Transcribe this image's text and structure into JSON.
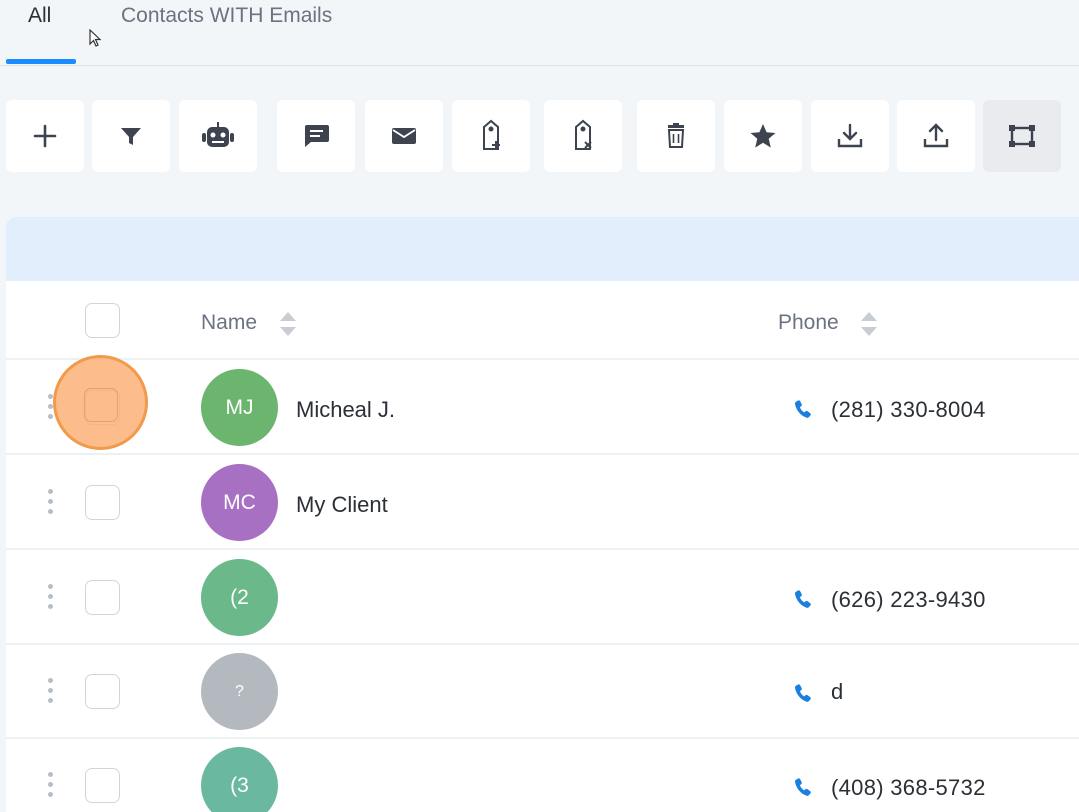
{
  "tabs": [
    {
      "label": "All",
      "active": true
    },
    {
      "label": "Contacts WITH Emails",
      "active": false
    }
  ],
  "toolbar": {
    "buttons": [
      {
        "icon": "plus-icon"
      },
      {
        "icon": "filter-icon"
      },
      {
        "icon": "robot-icon"
      },
      {
        "icon": "message-icon"
      },
      {
        "icon": "email-icon"
      },
      {
        "icon": "add-tag-icon"
      },
      {
        "icon": "remove-tag-icon"
      },
      {
        "icon": "trash-icon"
      },
      {
        "icon": "star-icon"
      },
      {
        "icon": "download-icon"
      },
      {
        "icon": "upload-icon"
      },
      {
        "icon": "columns-icon",
        "active": true
      }
    ]
  },
  "table": {
    "headers": {
      "name": "Name",
      "phone": "Phone"
    },
    "rows": [
      {
        "initials": "MJ",
        "name": "Micheal J.",
        "phone": "(281) 330-8004",
        "avatar_color": "#6bb56f"
      },
      {
        "initials": "MC",
        "name": "My Client",
        "phone": "",
        "avatar_color": "#a870c2"
      },
      {
        "initials": "(2",
        "name": "",
        "phone": "(626) 223-9430",
        "avatar_color": "#6bb88a"
      },
      {
        "initials": "?",
        "name": "",
        "phone": "d",
        "avatar_color": "#b3b9bf"
      },
      {
        "initials": "(3",
        "name": "",
        "phone": "(408) 368-5732",
        "avatar_color": "#6bb8a0"
      }
    ]
  },
  "colors": {
    "accent": "#1a8cff",
    "phone_icon": "#1a7fe0",
    "highlight": "#fbb078"
  }
}
